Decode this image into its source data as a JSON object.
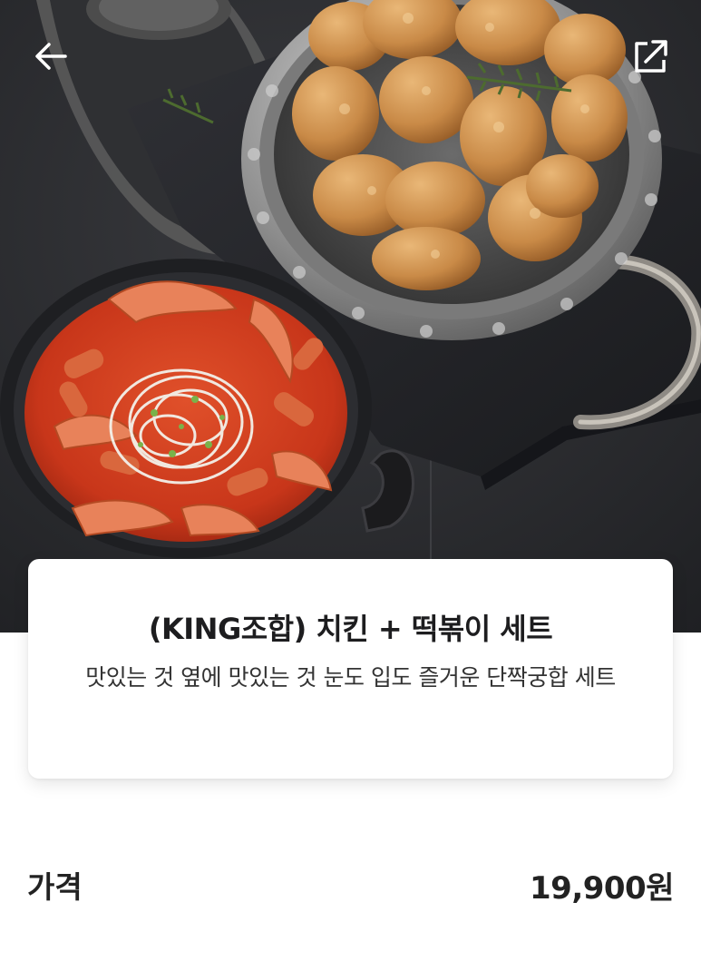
{
  "header": {
    "back_icon": "arrow-left-icon",
    "share_icon": "share-external-icon"
  },
  "product": {
    "title": "(KING조합) 치킨 + 떡볶이 세트",
    "description": "맛있는 것 옆에 맛있는 것 눈도 입도 즐거운 단짝궁합 세트"
  },
  "price": {
    "label": "가격",
    "value": "19,900원"
  },
  "colors": {
    "text_primary": "#1d1d1f",
    "card_bg": "#ffffff",
    "hero_bg": "#2b2c2f"
  }
}
